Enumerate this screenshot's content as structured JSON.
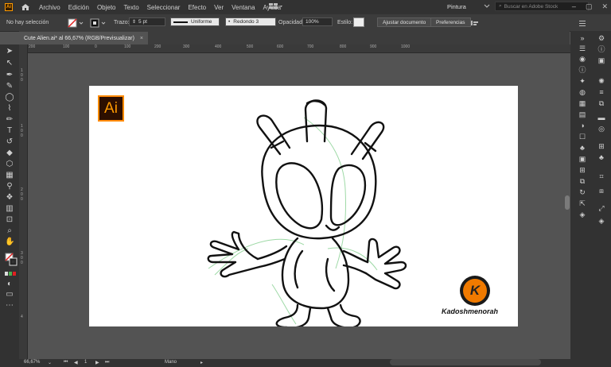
{
  "app": {
    "logo": "Ai"
  },
  "menu": [
    "Archivo",
    "Edición",
    "Objeto",
    "Texto",
    "Seleccionar",
    "Efecto",
    "Ver",
    "Ventana",
    "Ayuda"
  ],
  "workspace": "Pintura",
  "search_placeholder": "Buscar en Adobe Stock",
  "control": {
    "selection_status": "No hay selección",
    "stroke_label": "Trazo:",
    "stroke_weight": "5 pt",
    "profile": "Uniforme",
    "brush": "Redondo 3",
    "opacity_label": "Opacidad:",
    "opacity_value": "100%",
    "style_label": "Estilo:",
    "adjust_button": "Ajustar documento",
    "prefs_button": "Preferencias"
  },
  "document_tab": {
    "title": "Cute Alien.ai* al 66,67% (RGB/Previsualizar)",
    "close": "×"
  },
  "ruler_h": [
    "200",
    "100",
    "0",
    "100",
    "200",
    "300",
    "400",
    "500",
    "600",
    "700",
    "800",
    "900",
    "1000"
  ],
  "ruler_v": [
    "1",
    "0",
    "0",
    "1",
    "0",
    "0",
    "2",
    "0",
    "0",
    "3",
    "0",
    "0",
    "4"
  ],
  "artwork": {
    "watermark": "Kadoshmenorah",
    "k_letter": "K",
    "ai_badge": "Ai"
  },
  "status": {
    "zoom": "66,67%",
    "artboard": "1",
    "tool": "Mano"
  },
  "colors": {
    "accent_orange": "#ff9a00",
    "bg_dark": "#323232",
    "canvas": "#535353"
  }
}
